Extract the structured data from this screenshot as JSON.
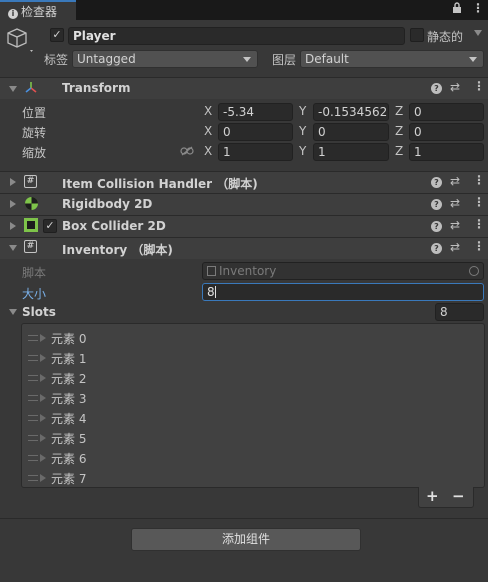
{
  "tab": {
    "title": "检查器",
    "icon": "info-icon"
  },
  "tab_buttons": {
    "lock": "lock-icon",
    "menu": "kebab-menu-icon"
  },
  "gameobject": {
    "active_checked": true,
    "name": "Player",
    "static_label": "静态的",
    "static_checked": false,
    "tag_label": "标签",
    "tag_value": "Untagged",
    "layer_label": "图层",
    "layer_value": "Default"
  },
  "transform": {
    "title": "Transform",
    "rows": [
      {
        "label": "位置",
        "x": "-5.34",
        "y": "-0.1534562",
        "z": "0"
      },
      {
        "label": "旋转",
        "x": "0",
        "y": "0",
        "z": "0"
      },
      {
        "label": "缩放",
        "x": "1",
        "y": "1",
        "z": "1"
      }
    ],
    "axis_x": "X",
    "axis_y": "Y",
    "axis_z": "Z"
  },
  "components": [
    {
      "title": "Item Collision Handler （脚本)",
      "has_checkbox": false
    },
    {
      "title": "Rigidbody 2D",
      "has_checkbox": false
    },
    {
      "title": "Box Collider 2D",
      "has_checkbox": true
    }
  ],
  "inventory": {
    "title": "Inventory （脚本)",
    "script_label": "脚本",
    "script_value": "Inventory",
    "size_label": "大小",
    "size_value": "8",
    "slots_label": "Slots",
    "slots_count": "8",
    "elements": [
      "元素 0",
      "元素 1",
      "元素 2",
      "元素 3",
      "元素 4",
      "元素 5",
      "元素 6",
      "元素 7"
    ],
    "add_symbol": "+",
    "remove_symbol": "−"
  },
  "add_component_label": "添加组件",
  "colors": {
    "accent": "#3a79bb",
    "panel": "#383838",
    "header": "#3e3e3e",
    "field": "#2a2a2a"
  }
}
